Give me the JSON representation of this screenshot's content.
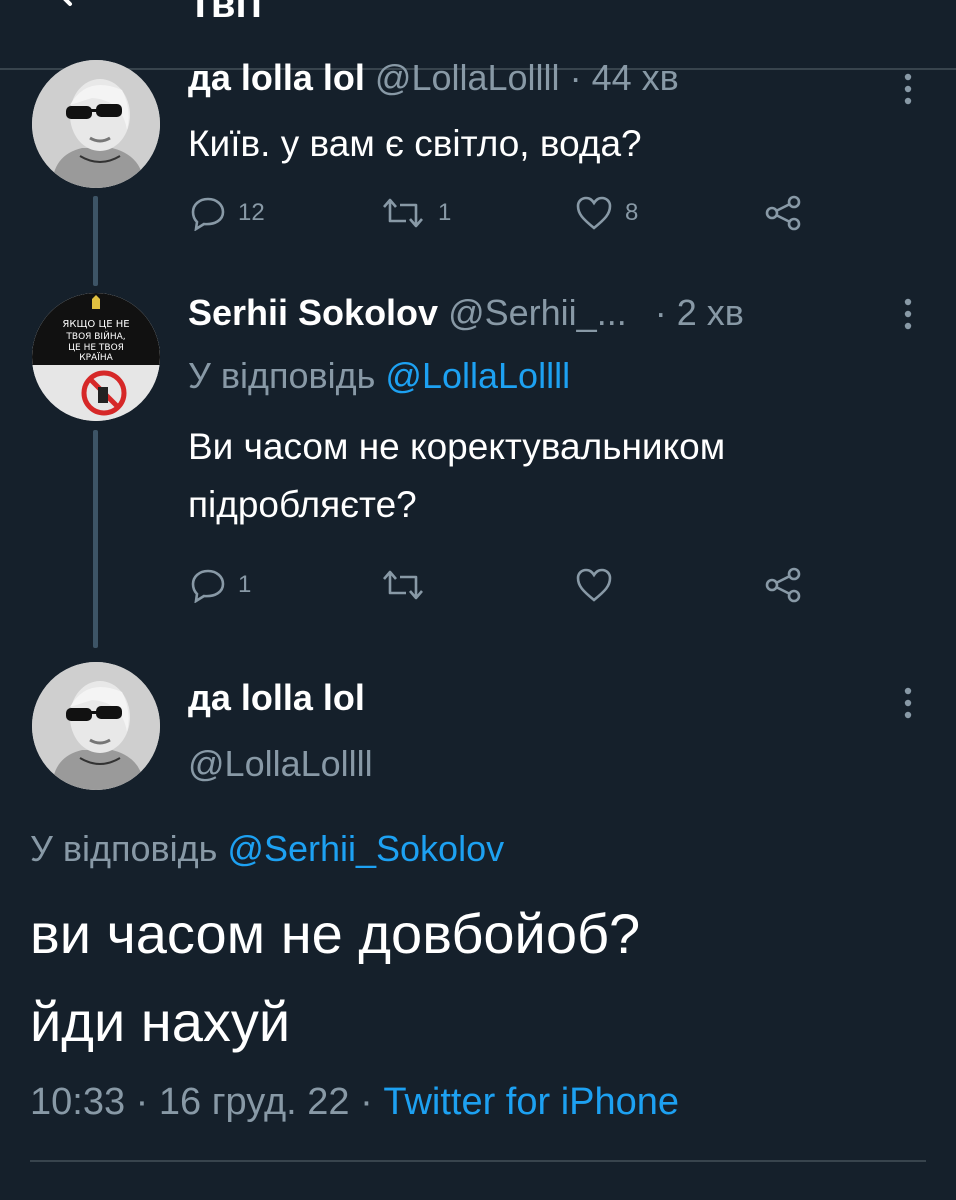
{
  "header": {
    "title": "Твіт"
  },
  "thread": [
    {
      "display_name": "да lolla lol",
      "handle": "@LollaLollll",
      "separator": "·",
      "time": "44 хв",
      "text": "Київ. у вам є світло, вода?",
      "replies": "12",
      "retweets": "1",
      "likes": "8"
    },
    {
      "display_name": "Serhii Sokolov",
      "handle": "@Serhii_...",
      "separator": "·",
      "time": "2 хв",
      "reply_prefix": "У відповідь",
      "reply_to": "@LollaLollll",
      "text_line1": "Ви часом не коректувальником",
      "text_line2": "підробляєте?",
      "replies": "1",
      "avatar_text": "ЯКЩО ЦЕ НЕ ТВОЯ ВІЙНА, ЦЕ НЕ ТВОЯ КРАЇНА"
    }
  ],
  "focused": {
    "display_name": "да lolla lol",
    "handle": "@LollaLollll",
    "reply_prefix": "У відповідь",
    "reply_to": "@Serhii_Sokolov",
    "text_line1": "ви часом не довбойоб?",
    "text_line2": "йди нахуй",
    "time": "10:33",
    "separator": "·",
    "date": "16 груд. 22",
    "separator2": "·",
    "source": "Twitter for iPhone"
  },
  "colors": {
    "background": "#15202b",
    "muted": "#8899a6",
    "accent": "#1da1f2",
    "divider": "#38444d"
  }
}
